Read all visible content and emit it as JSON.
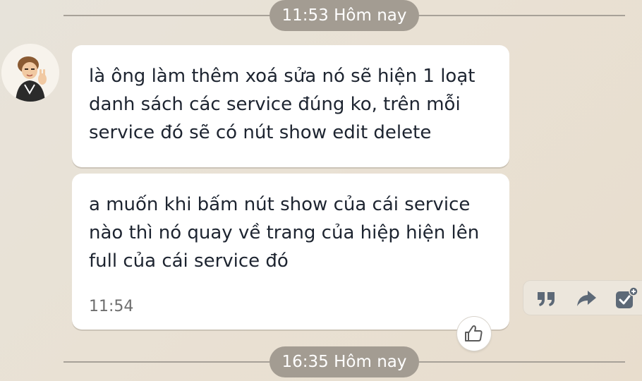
{
  "dividers": [
    {
      "label": "11:53 Hôm nay"
    },
    {
      "label": "16:35 Hôm nay"
    }
  ],
  "messages": [
    {
      "text": "là ông làm thêm xoá sửa nó sẽ hiện 1 loạt danh sách các service đúng ko, trên mỗi service đó sẽ có nút show edit delete"
    },
    {
      "text": "a muốn khi bấm nút show của cái service nào thì nó quay về trang của hiệp hiện lên full của cái service đó",
      "time": "11:54"
    }
  ],
  "icons": {
    "avatar": "user-avatar",
    "like": "thumbs-up-icon",
    "quote": "quote-icon",
    "forward": "forward-icon",
    "task": "add-task-icon"
  },
  "colors": {
    "divider_pill": "#a39c92",
    "bubble": "#ffffff",
    "action_icon": "#5d6977",
    "text": "#1d2430"
  }
}
